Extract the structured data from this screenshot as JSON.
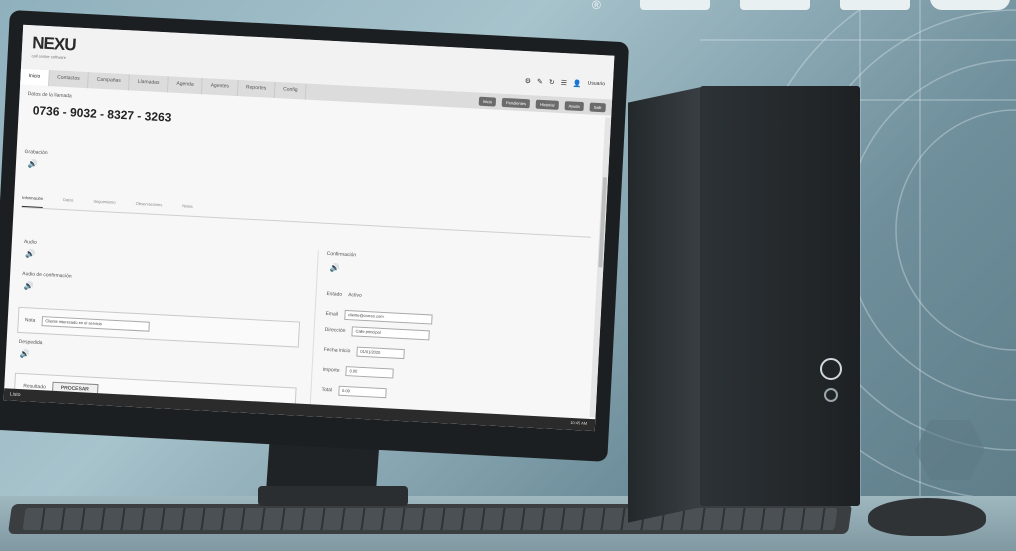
{
  "app": {
    "logo": "NEXU",
    "logo_tagline": "call center software"
  },
  "header": {
    "tabs": [
      "Inicio",
      "Contactos",
      "Campañas",
      "Llamadas",
      "Agenda",
      "Agentes",
      "Reportes",
      "Config"
    ],
    "user_name": "Usuario",
    "nav_buttons": [
      "Inicio",
      "Pendientes",
      "Historial",
      "Ayuda",
      "Salir"
    ]
  },
  "contact": {
    "section_label": "Datos de la llamada",
    "phone_number": "0736 - 9032 - 8327 - 3263",
    "audio_label": "Grabación"
  },
  "subtabs": [
    "Información",
    "Datos",
    "Seguimiento",
    "Observaciones",
    "Notas"
  ],
  "left_panel": {
    "audio1_label": "Audio",
    "audio2_label": "Audio de confirmación",
    "field_label": "Nota",
    "field_value": "Cliente interesado en el servicio",
    "audio3_label": "Despedida",
    "bottom_label": "Resultado",
    "bottom_button": "PROCESAR"
  },
  "right_panel": {
    "title": "Confirmación",
    "status_label": "Estado",
    "status_value": "Activo",
    "email_label": "Email",
    "email_value": "cliente@correo.com",
    "address_label": "Dirección",
    "address_value": "Calle principal",
    "date_label": "Fecha inicio",
    "date_value": "01/01/2020",
    "amount_label": "Importe",
    "amount_value": "0.00",
    "extra_label": "Total",
    "extra_value": "0.00"
  },
  "statusbar": {
    "left": "Listo",
    "right": "10:45 AM"
  },
  "icons": {
    "audio": "speaker-icon",
    "settings": "gear-icon",
    "user": "user-avatar"
  },
  "colors": {
    "accent": "#6b6b6b",
    "screen_bg": "#f7f7f7",
    "statusbar": "#2b2b2b"
  }
}
